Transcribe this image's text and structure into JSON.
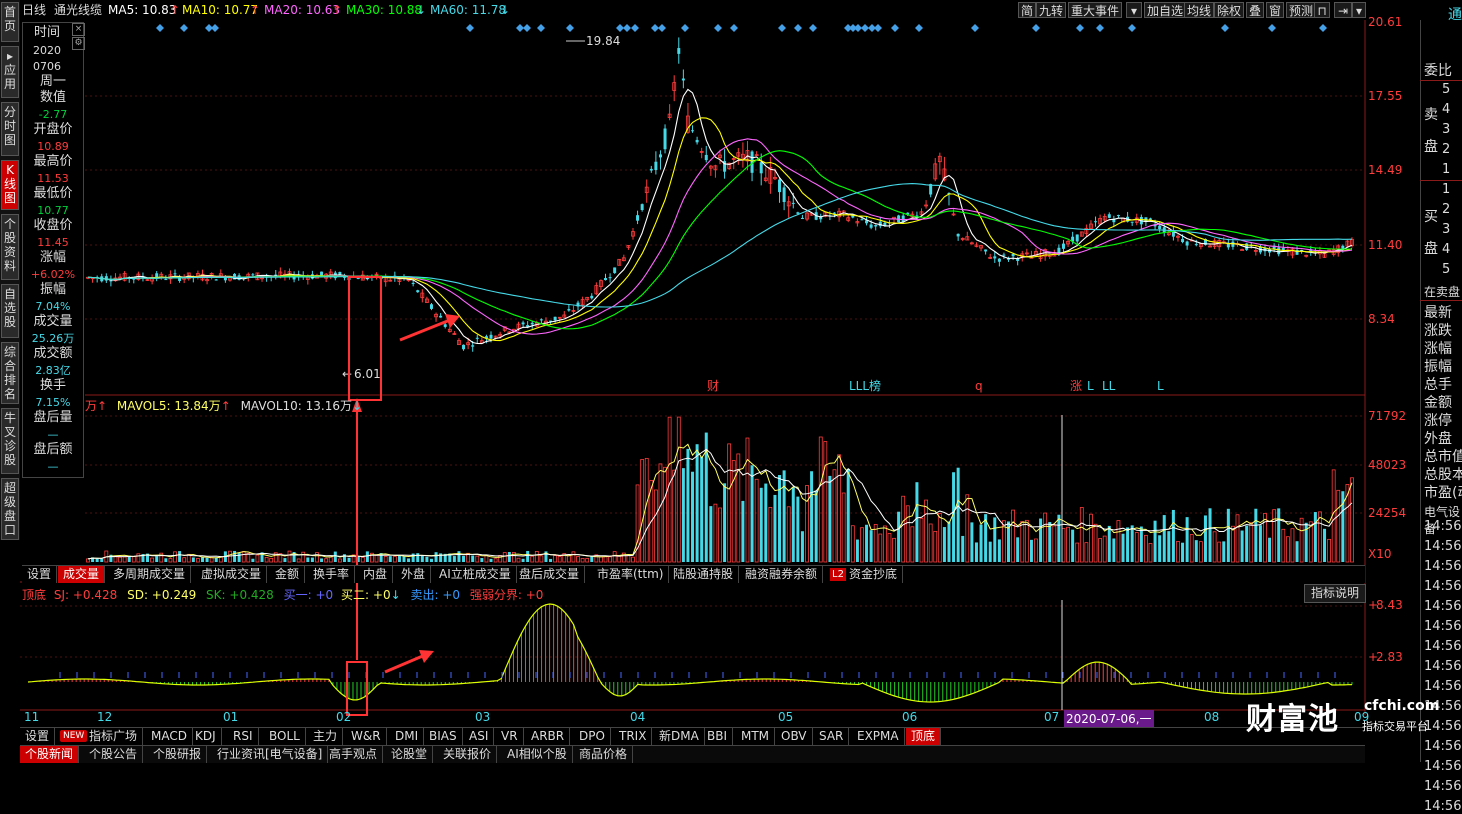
{
  "top_bar": {
    "period": "日线",
    "stock_name": "通光线缆",
    "ma5": "MA5: 10.83",
    "ma10": "MA10: 10.77",
    "ma20": "MA20: 10.63",
    "ma30": "MA30: 10.88",
    "ma60": "MA60: 11.78",
    "ma_colors": {
      "ma5": "#ffffff",
      "ma10": "#ffff00",
      "ma20": "#ff66ff",
      "ma30": "#00ff00",
      "ma60": "#45d9e8"
    },
    "buttons": [
      "简",
      "九转",
      "重大事件",
      "加自选",
      "均线",
      "除权",
      "叠",
      "窗",
      "预测"
    ],
    "right_symbol": "通"
  },
  "left_nav": [
    {
      "label": "首页",
      "active": false
    },
    {
      "label": "应用",
      "active": false
    },
    {
      "label": "分时图",
      "active": false
    },
    {
      "label": "K线图",
      "active": true
    },
    {
      "label": "个股资料",
      "active": false
    },
    {
      "label": "自选股",
      "active": false
    },
    {
      "label": "综合排名",
      "active": false
    },
    {
      "label": "牛叉诊股",
      "active": false
    },
    {
      "label": "超级盘口",
      "active": false
    }
  ],
  "info_panel": {
    "time_label": "时间",
    "date_year": "2020",
    "date_md": "0706",
    "weekday": "周一",
    "value_label": "数值",
    "value": "-2.77",
    "open_label": "开盘价",
    "open": "10.89",
    "high_label": "最高价",
    "high": "11.53",
    "low_label": "最低价",
    "low": "10.77",
    "close_label": "收盘价",
    "close": "11.45",
    "change_label": "涨幅",
    "change": "+6.02%",
    "amp_label": "振幅",
    "amp": "7.04%",
    "vol_label": "成交量",
    "vol": "25.26万",
    "amt_label": "成交额",
    "amt": "2.83亿",
    "turnover_label": "换手",
    "turnover": "7.15%",
    "after_vol_label": "盘后量",
    "after_vol": "—",
    "after_amt_label": "盘后额",
    "after_amt": "—"
  },
  "price_axis": [
    "20.61",
    "17.55",
    "14.49",
    "11.40",
    "8.34"
  ],
  "price_annotations": {
    "high": "19.84",
    "low": "6.01"
  },
  "event_markers": [
    "财",
    "LLL榜",
    "q",
    "涨",
    "L",
    "LL",
    "L"
  ],
  "volume_header": {
    "unit": "万",
    "mavol5": "MAVOL5: 13.84万",
    "mavol10": "MAVOL10: 13.16万"
  },
  "volume_axis": [
    "71792",
    "48023",
    "24254",
    "X10"
  ],
  "indicator_tabs": [
    "设置",
    "成交量",
    "多周期成交量",
    "虚拟成交量",
    "金额",
    "换手率",
    "内盘",
    "外盘",
    "AI立桩成交量",
    "盘后成交量",
    "市盈率(ttm)",
    "陆股通持股",
    "融资融券余额",
    "资金抄底"
  ],
  "indicator_tabs_active": "成交量",
  "l2_badge": "L2",
  "oscillator_header": {
    "name": "顶底",
    "sj": "SJ: +0.428",
    "sd": "SD: +0.249",
    "sk": "SK: +0.428",
    "buy1": "买一: +0",
    "buy2": "买二: +0",
    "sell": "卖出: +0",
    "strong": "强弱分界: +0"
  },
  "indicator_explain": "指标说明",
  "oscillator_axis": [
    "8.43",
    "2.83"
  ],
  "date_axis": [
    "11",
    "12",
    "01",
    "02",
    "03",
    "04",
    "05",
    "06",
    "07",
    "08",
    "09"
  ],
  "date_cursor": "2020-07-06,一",
  "bottom_tabs": [
    "设置",
    "指标广场",
    "MACD",
    "KDJ",
    "RSI",
    "BOLL",
    "主力",
    "W&R",
    "DMI",
    "BIAS",
    "ASI",
    "VR",
    "ARBR",
    "DPO",
    "TRIX",
    "新DMA",
    "BBI",
    "MTM",
    "OBV",
    "SAR",
    "EXPMA",
    "顶底"
  ],
  "bottom_tabs_active": "顶底",
  "new_badge": "NEW",
  "news_tabs": [
    "个股新闻",
    "个股公告",
    "个股研报",
    "行业资讯[电气设备]",
    "高手观点",
    "论股堂",
    "关联报价",
    "AI相似个股",
    "商品价格"
  ],
  "right_panel": {
    "ratio_label": "委比",
    "sell_label": "卖盘",
    "buy_label": "买盘",
    "sell_levels": [
      "5",
      "4",
      "3",
      "2",
      "1"
    ],
    "buy_levels": [
      "1",
      "2",
      "3",
      "4",
      "5"
    ],
    "queue_label": "在卖盘",
    "stats": [
      "最新",
      "涨跌",
      "涨幅",
      "振幅",
      "总手",
      "金额",
      "涨停",
      "外盘",
      "总市值",
      "总股本",
      "市盈(动)"
    ],
    "industry": "电气设备",
    "times": [
      "14:56",
      "14:56",
      "14:56",
      "14:56",
      "14:56",
      "14:56",
      "14:56",
      "14:56",
      "14:56",
      "14:56",
      "14:56",
      "14:56",
      "14:56",
      "14:56",
      "14:56"
    ]
  },
  "watermark": {
    "brand": "财富池",
    "site": "cfchi.com",
    "slogan": "指标交易平台"
  },
  "colors": {
    "up": "#ff3c3c",
    "down": "#45d9e8",
    "accent": "#cc0000",
    "annotation": "#ff3333"
  }
}
